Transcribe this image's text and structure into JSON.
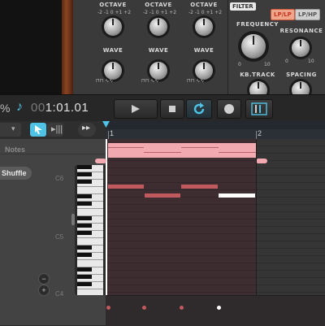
{
  "synth": {
    "osc_columns": [
      {
        "octave_label": "OCTAVE",
        "wave_label": "WAVE"
      },
      {
        "octave_label": "OCTAVE",
        "wave_label": "WAVE"
      },
      {
        "octave_label": "OCTAVE",
        "wave_label": "WAVE"
      }
    ],
    "filter": {
      "tag": "FILTER",
      "mode_buttons": [
        "LP/LP",
        "LP/HP"
      ],
      "active_mode": "LP/LP",
      "frequency_label": "FREQUENCY",
      "resonance_label": "RESONANCE",
      "kbtrack_label": "KB.TRACK",
      "spacing_label": "SPACING",
      "scale_min": "0",
      "scale_max": "10"
    },
    "colors": {
      "active_button": "#f0a58a",
      "wood": "#8a4422"
    }
  },
  "transport": {
    "percent_suffix": "%",
    "note_icon": "eighth-note-icon",
    "position_dim": "00",
    "position": "1:01.01",
    "buttons": [
      "play-icon",
      "stop-icon",
      "loop-icon",
      "record-icon",
      "metronome-icon"
    ],
    "loop_active": true
  },
  "toolbar": {
    "tools": [
      "pointer-tool",
      "split-tool",
      "fast-forward-icon"
    ],
    "active_tool": "pointer-tool"
  },
  "ruler": {
    "marks": [
      "1",
      "2"
    ]
  },
  "left_panel": {
    "notes_label": "Notes",
    "shuffle_label": "Shuffle",
    "keyboard_labels": [
      "C6",
      "C5",
      "C4"
    ],
    "zoom_minus": "−",
    "zoom_plus": "+"
  },
  "colors": {
    "accent": "#4ec3e6",
    "clip": "#f2a9b0",
    "note": "#c05a5e",
    "selected_note": "#ffffff"
  }
}
